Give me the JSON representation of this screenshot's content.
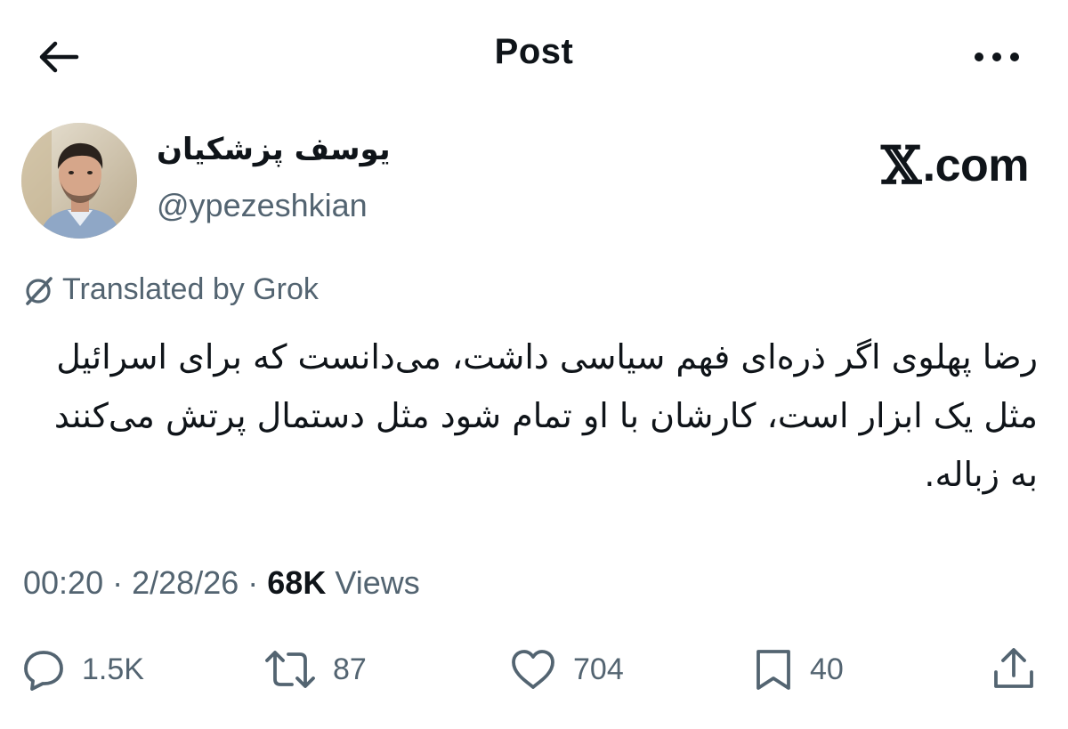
{
  "header": {
    "title": "Post",
    "back_icon": "arrow-left-icon",
    "more_icon": "more-horizontal-icon"
  },
  "author": {
    "display_name": "یوسف پزشکیان",
    "handle": "@ypezeshkian"
  },
  "watermark": {
    "mark": "𝕏",
    "text": ".com"
  },
  "translation": {
    "label": "Translated by Grok",
    "icon": "grok-icon"
  },
  "tweet": {
    "text": "رضا پهلوی اگر ذره‌ای فهم سیاسی داشت، می‌دانست که برای اسرائیل مثل یک ابزار است، کارشان با او تمام شود مثل دستمال پرتش می‌کنند به زباله."
  },
  "meta": {
    "time": "00:20",
    "separator": "·",
    "date": "2/28/26",
    "views_count": "68K",
    "views_label": "Views"
  },
  "actions": {
    "replies": "1.5K",
    "reposts": "87",
    "likes": "704",
    "bookmarks": "40",
    "reply_icon": "reply-icon",
    "repost_icon": "repost-icon",
    "like_icon": "heart-icon",
    "bookmark_icon": "bookmark-icon",
    "share_icon": "share-icon"
  },
  "colors": {
    "text_primary": "#0f1419",
    "text_secondary": "#536471",
    "background": "#ffffff"
  }
}
